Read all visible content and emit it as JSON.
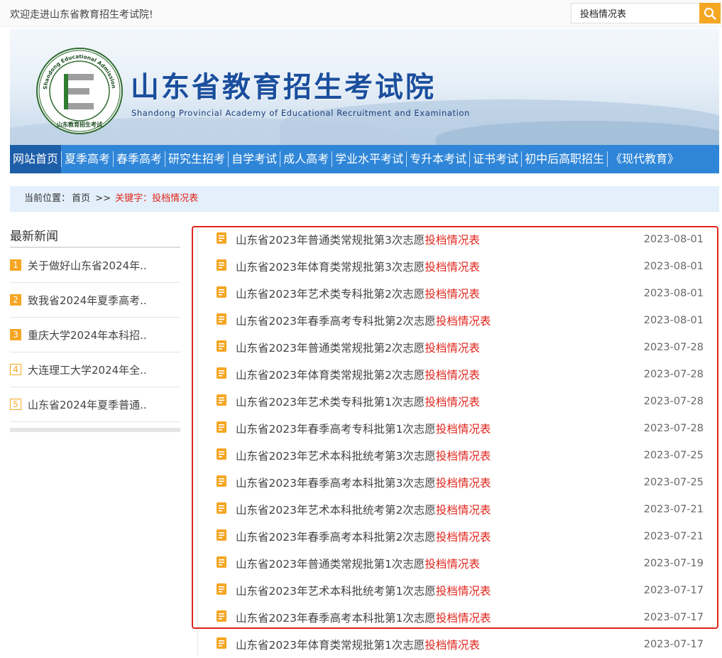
{
  "header": {
    "welcome": "欢迎走进山东省教育招生考试院!",
    "search_value": "投档情况表"
  },
  "banner": {
    "title_cn": "山东省教育招生考试院",
    "title_en": "Shandong Provincial Academy of Educational Recruitment and Examination",
    "logo_ring_text": "Shandong Educational Admission & Examinations",
    "logo_bottom_text": "山东教育招生考试"
  },
  "nav": {
    "items": [
      "网站首页",
      "夏季高考",
      "春季高考",
      "研究生招考",
      "自学考试",
      "成人高考",
      "学业水平考试",
      "专升本考试",
      "证书考试",
      "初中后高职招生",
      "《现代教育》"
    ]
  },
  "breadcrumb": {
    "prefix": "当前位置：",
    "home": "首页",
    "sep": ">>",
    "keyword_label": "关键字：",
    "keyword": "投档情况表"
  },
  "sidebar": {
    "title": "最新新闻",
    "items": [
      {
        "num": "1",
        "text": "关于做好山东省2024年.."
      },
      {
        "num": "2",
        "text": "致我省2024年夏季高考.."
      },
      {
        "num": "3",
        "text": "重庆大学2024年本科招.."
      },
      {
        "num": "4",
        "text": "大连理工大学2024年全.."
      },
      {
        "num": "5",
        "text": "山东省2024年夏季普通.."
      }
    ]
  },
  "list": {
    "items": [
      {
        "prefix": "山东省2023年普通类常规批第3次志愿",
        "hl": "投档情况表",
        "date": "2023-08-01"
      },
      {
        "prefix": "山东省2023年体育类常规批第3次志愿",
        "hl": "投档情况表",
        "date": "2023-08-01"
      },
      {
        "prefix": "山东省2023年艺术类专科批第2次志愿",
        "hl": "投档情况表",
        "date": "2023-08-01"
      },
      {
        "prefix": "山东省2023年春季高考专科批第2次志愿",
        "hl": "投档情况表",
        "date": "2023-08-01"
      },
      {
        "prefix": "山东省2023年普通类常规批第2次志愿",
        "hl": "投档情况表",
        "date": "2023-07-28"
      },
      {
        "prefix": "山东省2023年体育类常规批第2次志愿",
        "hl": "投档情况表",
        "date": "2023-07-28"
      },
      {
        "prefix": "山东省2023年艺术类专科批第1次志愿",
        "hl": "投档情况表",
        "date": "2023-07-28"
      },
      {
        "prefix": "山东省2023年春季高考专科批第1次志愿",
        "hl": "投档情况表",
        "date": "2023-07-28"
      },
      {
        "prefix": "山东省2023年艺术本科批统考第3次志愿",
        "hl": "投档情况表",
        "date": "2023-07-25"
      },
      {
        "prefix": "山东省2023年春季高考本科批第3次志愿",
        "hl": "投档情况表",
        "date": "2023-07-25"
      },
      {
        "prefix": "山东省2023年艺术本科批统考第2次志愿",
        "hl": "投档情况表",
        "date": "2023-07-21"
      },
      {
        "prefix": "山东省2023年春季高考本科批第2次志愿",
        "hl": "投档情况表",
        "date": "2023-07-21"
      },
      {
        "prefix": "山东省2023年普通类常规批第1次志愿",
        "hl": "投档情况表",
        "date": "2023-07-19"
      },
      {
        "prefix": "山东省2023年艺术本科批统考第1次志愿",
        "hl": "投档情况表",
        "date": "2023-07-17"
      },
      {
        "prefix": "山东省2023年春季高考本科批第1次志愿",
        "hl": "投档情况表",
        "date": "2023-07-17"
      },
      {
        "prefix": "山东省2023年体育类常规批第1次志愿",
        "hl": "投档情况表",
        "date": "2023-07-17"
      }
    ]
  },
  "colors": {
    "nav_bg": "#2f86d8",
    "nav_active": "#1d5ea8",
    "highlight": "#e0261d",
    "accent": "#f5a623"
  }
}
